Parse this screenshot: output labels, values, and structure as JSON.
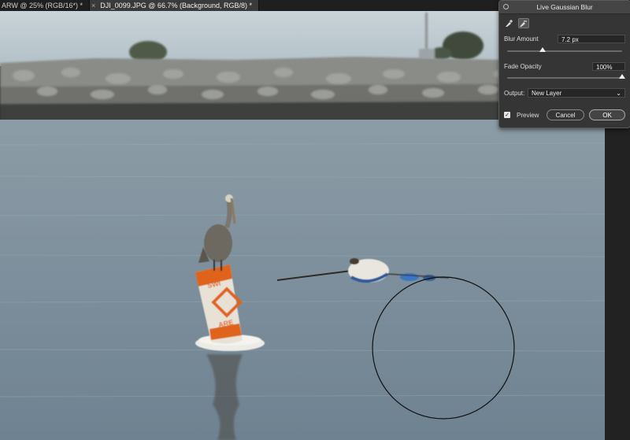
{
  "tabs": [
    {
      "label": "ARW @ 25% (RGB/16*) *",
      "close": "×",
      "active": false
    },
    {
      "label": "DJI_0099.JPG @ 66.7% (Background, RGB/8) *",
      "close": "×",
      "active": true
    }
  ],
  "dialog": {
    "title": "Live Gaussian Blur",
    "tool_icons": [
      "blur-brush-add-icon",
      "blur-brush-subtract-icon"
    ],
    "blur_amount": {
      "label": "Blur Amount",
      "value": "7.2 px",
      "slider_fraction": 0.31
    },
    "fade_opacity": {
      "label": "Fade Opacity",
      "value": "100%",
      "slider_fraction": 1.0
    },
    "output": {
      "label": "Output:",
      "selected": "New Layer"
    },
    "preview": {
      "label": "Preview",
      "checked": true
    },
    "cancel_label": "Cancel",
    "ok_label": "OK"
  },
  "colors": {
    "sky": "#b9c6cd",
    "water": "#7f909c",
    "buoy_orange": "#e0641e",
    "dialog_bg": "#353535"
  }
}
